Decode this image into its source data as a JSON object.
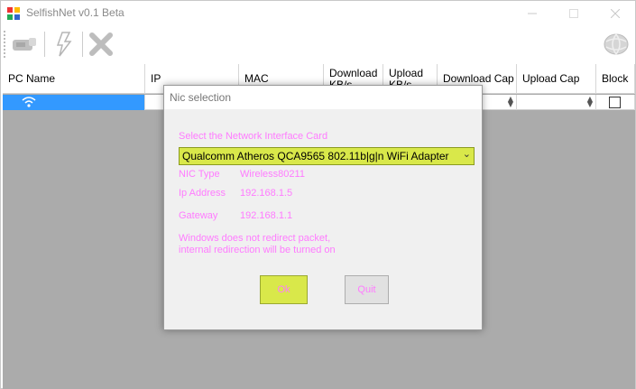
{
  "window": {
    "title": "SelfishNet v0.1 Beta"
  },
  "toolbar": {
    "buttons": [
      {
        "name": "network-card-icon"
      },
      {
        "name": "lightning-icon"
      },
      {
        "name": "remove-x-icon"
      },
      {
        "name": "globe-icon"
      }
    ]
  },
  "grid": {
    "columns": [
      "PC Name",
      "IP",
      "MAC",
      "Download KB/s",
      "Upload KB/s",
      "Download Cap",
      "Upload Cap",
      "Block"
    ]
  },
  "dialog": {
    "title": "Nic selection",
    "prompt": "Select the Network Interface Card",
    "selected_adapter": "Qualcomm Atheros QCA9565 802.11b|g|n WiFi Adapter",
    "nic_type_label": "NIC Type",
    "nic_type_value": "Wireless80211",
    "ip_label": "Ip Address",
    "ip_value": "192.168.1.5",
    "gateway_label": "Gateway",
    "gateway_value": "192.168.1.1",
    "warning_line1": "Windows does not redirect packet,",
    "warning_line2": "internal redirection will be turned on",
    "ok_label": "Ok",
    "quit_label": "Quit"
  },
  "colors": {
    "accent_yellow": "#d9e84a",
    "label_pink": "#ff7bff",
    "selection_blue": "#3399ff"
  }
}
